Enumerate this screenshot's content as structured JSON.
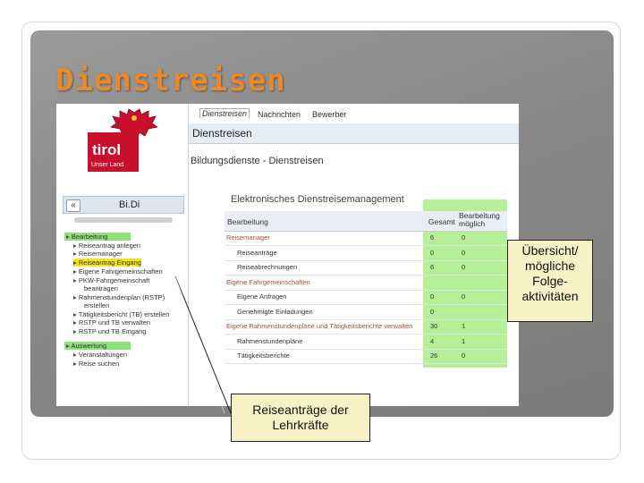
{
  "slide": {
    "title": "Dienstreisen"
  },
  "logo": {
    "brand": "tirol",
    "tagline": "Unser Land"
  },
  "sidebar": {
    "title": "Bi.Di",
    "collapse_label": "«",
    "items": [
      {
        "label": "Bearbeitung",
        "level": 0,
        "highlight": "green"
      },
      {
        "label": "Reiseantrag anlegen",
        "level": 1
      },
      {
        "label": "Reisemanager",
        "level": 1
      },
      {
        "label": "Reiseantrag Eingang",
        "level": 1,
        "highlight": "yellow"
      },
      {
        "label": "Eigene Fahrgemeinschaften",
        "level": 1
      },
      {
        "label": "PKW-Fahrgemeinschaft",
        "level": 1
      },
      {
        "label": "beantragen",
        "level": 2
      },
      {
        "label": "Rahmenstundenplan (RSTP)",
        "level": 1
      },
      {
        "label": "erstellen",
        "level": 2
      },
      {
        "label": "Tätigkeitsbericht (TB) erstellen",
        "level": 1
      },
      {
        "label": "RSTP und TB verwalten",
        "level": 1
      },
      {
        "label": "RSTP und TB Eingang",
        "level": 1
      },
      {
        "label": "Auswertung",
        "level": 0,
        "highlight": "green"
      },
      {
        "label": "Veranstaltungen",
        "level": 1
      },
      {
        "label": "Reise suchen",
        "level": 1
      }
    ]
  },
  "tabs": [
    "Dienstreisen",
    "Nachrichten",
    "Bewerber"
  ],
  "page": {
    "header": "Dienstreisen",
    "section": "Bildungsdienste - Dienstreisen",
    "subsection": "Elektronisches Dienstreisemanagement"
  },
  "table": {
    "headers": [
      "Bearbeitung",
      "Gesamt",
      "Bearbeitung möglich"
    ],
    "rows": [
      {
        "label": "Reisemanager",
        "type": "group",
        "total": "6",
        "possible": "0"
      },
      {
        "label": "Reiseanträge",
        "type": "child",
        "total": "0",
        "possible": "0"
      },
      {
        "label": "Reiseabrechnungen",
        "type": "child",
        "total": "6",
        "possible": "0"
      },
      {
        "label": "Eigene Fahrgemeinschaften",
        "type": "group",
        "total": "",
        "possible": ""
      },
      {
        "label": "Eigene Anfragen",
        "type": "child",
        "total": "0",
        "possible": "0"
      },
      {
        "label": "Genehmigte Einladungen",
        "type": "child",
        "total": "0",
        "possible": ""
      },
      {
        "label": "Eigene Rahmenstundenpläne und Tätigkeitsberichte verwalten",
        "type": "group",
        "total": "30",
        "possible": "1"
      },
      {
        "label": "Rahmenstundenpläne",
        "type": "child",
        "total": "4",
        "possible": "1"
      },
      {
        "label": "Tätigkeitsberichte",
        "type": "child",
        "total": "26",
        "possible": "0"
      }
    ]
  },
  "callouts": {
    "right": [
      "Übersicht/",
      "mögliche",
      "Folge-",
      "aktivitäten"
    ],
    "bottom": [
      "Reiseanträge der",
      "Lehrkräfte"
    ]
  },
  "colors": {
    "title": "#e88a2a",
    "highlight_green": "#8fe07a",
    "highlight_yellow": "#f4e41e",
    "tirol_red": "#c8102e"
  }
}
